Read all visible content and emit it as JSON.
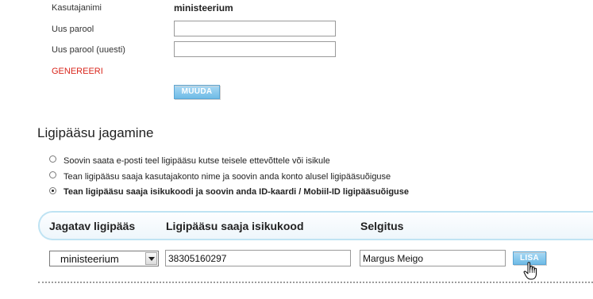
{
  "account": {
    "username_label": "Kasutajanimi",
    "username_value": "ministeerium",
    "new_password_label": "Uus parool",
    "new_password_value": "",
    "repeat_password_label": "Uus parool (uuesti)",
    "repeat_password_value": "",
    "generate_link": "GENEREERI",
    "change_button": "MUUDA"
  },
  "sharing": {
    "title": "Ligipääsu jagamine",
    "options": [
      {
        "label": "Soovin saata e-posti teel ligipääsu kutse teisele ettevõttele või isikule",
        "checked": false
      },
      {
        "label": "Tean ligipääsu saaja kasutajakonto nime ja soovin anda konto alusel ligipääsuõiguse",
        "checked": false
      },
      {
        "label": "Tean ligipääsu saaja isikukoodi ja soovin anda ID-kaardi / Mobiil-ID ligipääsuõiguse",
        "checked": true
      }
    ],
    "table": {
      "headers": [
        "Jagatav ligipääs",
        "Ligipääsu saaja isikukood",
        "Selgitus"
      ],
      "selected_access": "ministeerium",
      "personal_code": "38305160297",
      "explanation": "Margus Meigo",
      "add_button": "LISA"
    }
  },
  "colors": {
    "button_blue": "#6fbbe6",
    "link_red": "#d9261c",
    "header_border": "#bfe3f3"
  },
  "icons": {
    "cursor": "hand-pointer-icon",
    "dropdown": "chevron-down-icon"
  }
}
